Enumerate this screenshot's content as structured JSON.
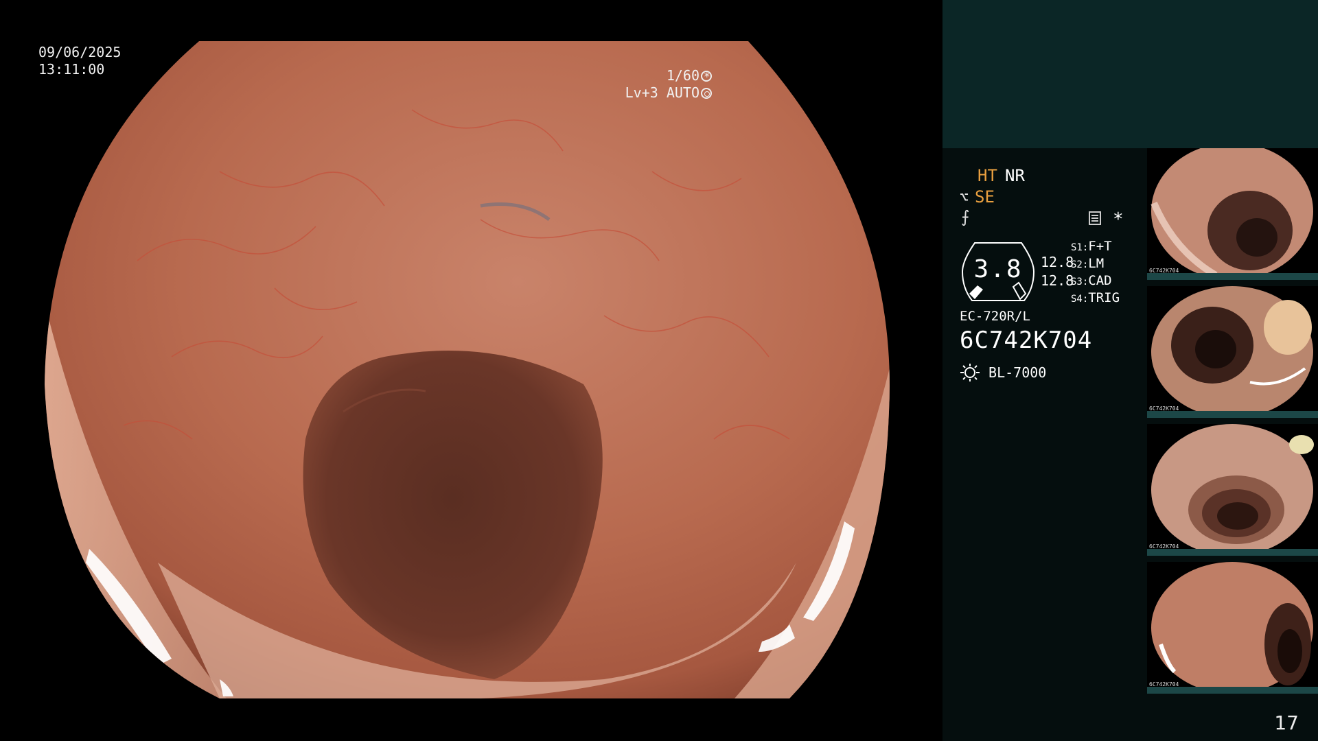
{
  "overlay": {
    "date": "09/06/2025",
    "time": "13:11:00",
    "shutter": "1/60",
    "exposure": "Lv+3 AUTO"
  },
  "panel": {
    "ht": "HT",
    "nr": "NR",
    "se": "SE",
    "asterisk": "*",
    "gauge_value": "3.8",
    "gauge_max": "12.8",
    "gauge_min": "12.8",
    "switches": [
      {
        "key": "S1:",
        "value": "F+T"
      },
      {
        "key": "S2:",
        "value": "LM"
      },
      {
        "key": "S3:",
        "value": "CAD"
      },
      {
        "key": "S4:",
        "value": "TRIG"
      }
    ],
    "scope_model": "EC-720R/L",
    "scope_serial": "6C742K704",
    "light_source": "BL-7000",
    "accent_color": "#e9a040",
    "top_panel_color": "#0b2626",
    "panel_color": "#050e0e"
  },
  "thumbnails": [
    {
      "id": "6C742K704",
      "index": "1"
    },
    {
      "id": "6C742K704",
      "index": "2"
    },
    {
      "id": "6C742K704",
      "index": "3"
    },
    {
      "id": "6C742K704",
      "index": "4"
    }
  ],
  "page_number": "17"
}
